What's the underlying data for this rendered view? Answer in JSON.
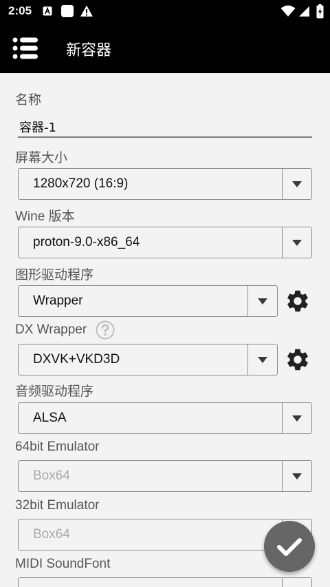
{
  "status_bar": {
    "time": "2:05",
    "icons": [
      "notification-a-icon",
      "square-icon",
      "alert-icon",
      "wifi-icon",
      "signal-icon",
      "battery-icon"
    ]
  },
  "app_bar": {
    "menu_icon": "list-menu-icon",
    "title": "新容器"
  },
  "form": {
    "name": {
      "label": "名称",
      "value": "容器-1"
    },
    "screen_size": {
      "label": "屏幕大小",
      "value": "1280x720 (16:9)"
    },
    "wine_version": {
      "label": "Wine 版本",
      "value": "proton-9.0-x86_64"
    },
    "graphics_driver": {
      "label": "图形驱动程序",
      "value": "Wrapper"
    },
    "dx_wrapper": {
      "label": "DX Wrapper",
      "value": "DXVK+VKD3D"
    },
    "audio_driver": {
      "label": "音频驱动程序",
      "value": "ALSA"
    },
    "emulator_64": {
      "label": "64bit Emulator",
      "value": "Box64"
    },
    "emulator_32": {
      "label": "32bit Emulator",
      "value": "Box64"
    },
    "midi_soundfont": {
      "label": "MIDI SoundFont"
    }
  },
  "fab": {
    "icon": "check-icon"
  },
  "colors": {
    "app_bar": "#000000",
    "background": "#f3f3f3",
    "fab": "#666666"
  }
}
